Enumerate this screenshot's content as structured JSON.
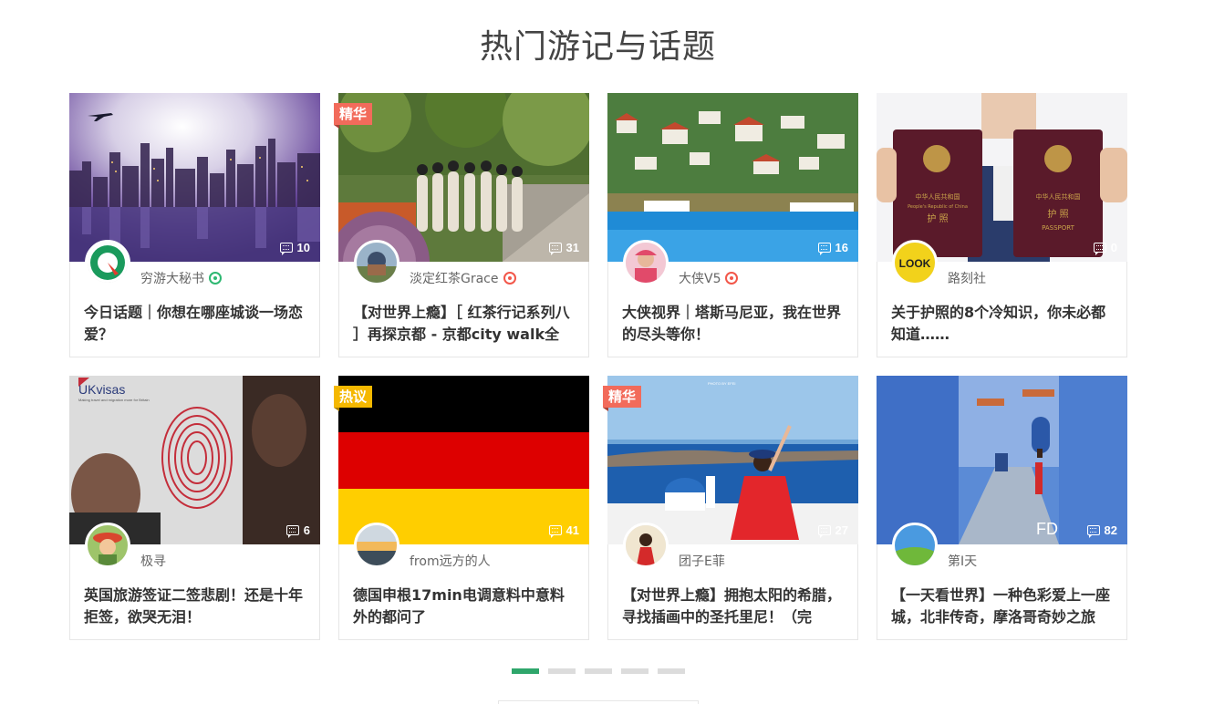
{
  "section_title": "热门游记与话题",
  "cards": [
    {
      "tag": "",
      "comments": "10",
      "author": "穷游大秘书",
      "verify": "green",
      "title": "今日话题｜你想在哪座城谈一场恋爱？"
    },
    {
      "tag": "精华",
      "comments": "31",
      "author": "淡定红茶Grace",
      "verify": "red",
      "title": "【对世界上瘾】［ 红茶行记系列八 ］再探京都 - 京都city walk全"
    },
    {
      "tag": "",
      "comments": "16",
      "author": "大侠V5",
      "verify": "red",
      "title": "大侠视界｜塔斯马尼亚，我在世界的尽头等你！"
    },
    {
      "tag": "",
      "comments": "0",
      "author": "路刻社",
      "verify": "",
      "title": "关于护照的8个冷知识，你未必都知道……"
    },
    {
      "tag": "",
      "comments": "6",
      "author": "极寻",
      "verify": "",
      "title": "英国旅游签证二签悲剧！还是十年拒签，欲哭无泪！"
    },
    {
      "tag": "热议",
      "comments": "41",
      "author": "from远方的人",
      "verify": "",
      "title": "德国申根17min电调意料中意料外的都问了"
    },
    {
      "tag": "精华",
      "comments": "27",
      "author": "团子E菲",
      "verify": "",
      "title": "【对世界上瘾】拥抱太阳的希腊，寻找插画中的圣托里尼！（完"
    },
    {
      "tag": "",
      "comments": "82",
      "author": "第I天",
      "verify": "",
      "title": "【一天看世界】一种色彩爱上一座城，北非传奇，摩洛哥奇妙之旅"
    }
  ],
  "image_text": {
    "ukvisas_logo": "UKvisas",
    "ukvisas_tagline": "Making travel and migration more for Britain",
    "photo_credit": "PHOTO BY EFEI",
    "passport_title": "PASSPORT",
    "passport_cn": "护  照",
    "passport_country": "中华人民共和国",
    "passport_country_en": "People's Republic of China",
    "look_logo": "LOOK",
    "fd_mark": "FD"
  },
  "pagination": {
    "count": 5,
    "active": 0
  }
}
